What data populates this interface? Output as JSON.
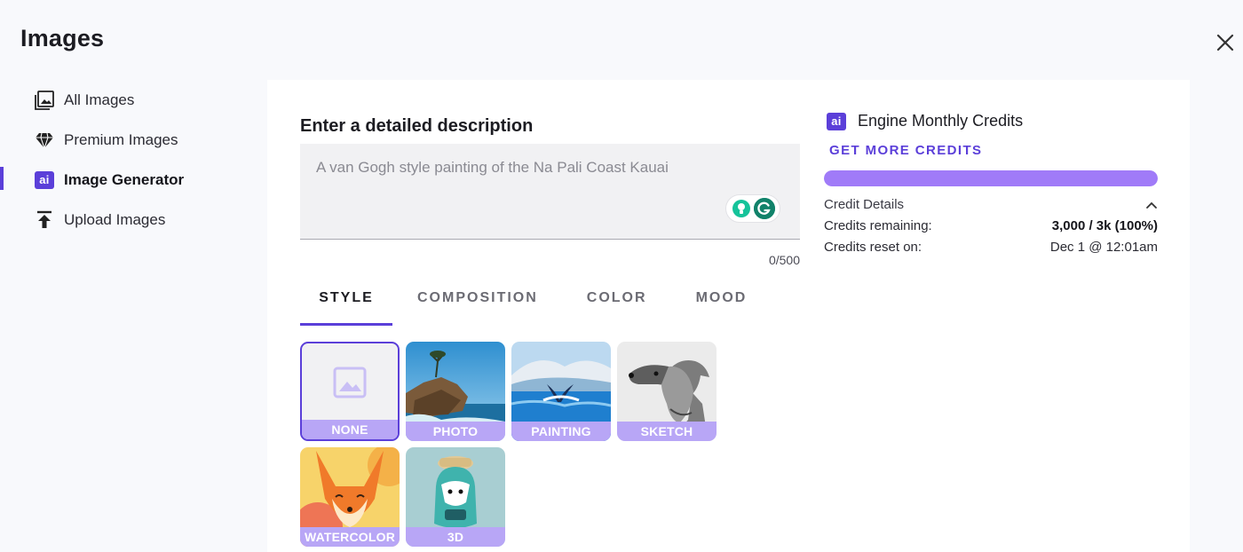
{
  "page": {
    "title": "Images"
  },
  "sidebar": {
    "items": [
      {
        "label": "All Images",
        "icon": "gallery-icon"
      },
      {
        "label": "Premium Images",
        "icon": "diamond-icon"
      },
      {
        "label": "Image Generator",
        "icon": "ai-icon",
        "active": true
      },
      {
        "label": "Upload Images",
        "icon": "upload-icon"
      }
    ],
    "ai_badge": "ai"
  },
  "prompt": {
    "label": "Enter a detailed description",
    "placeholder": "A van Gogh style painting of the Na Pali Coast Kauai",
    "counter": "0/500"
  },
  "tabs": [
    {
      "label": "STYLE",
      "active": true
    },
    {
      "label": "COMPOSITION"
    },
    {
      "label": "COLOR"
    },
    {
      "label": "MOOD"
    }
  ],
  "styles": [
    {
      "label": "NONE",
      "selected": true
    },
    {
      "label": "PHOTO"
    },
    {
      "label": "PAINTING"
    },
    {
      "label": "SKETCH"
    },
    {
      "label": "WATERCOLOR"
    },
    {
      "label": "3D"
    }
  ],
  "credits": {
    "ai_badge": "ai",
    "title": "Engine Monthly Credits",
    "get_more": "GET MORE CREDITS",
    "fill_fraction": 1.0,
    "details_label": "Credit Details",
    "remaining_label": "Credits remaining:",
    "remaining_value": "3,000 / 3k (100%)",
    "reset_label": "Credits reset on:",
    "reset_value": "Dec 1 @ 12:01am"
  },
  "colors": {
    "accent": "#5b3fd9",
    "bar": "#a07bf8",
    "tile_label": "#b8a6f6"
  }
}
